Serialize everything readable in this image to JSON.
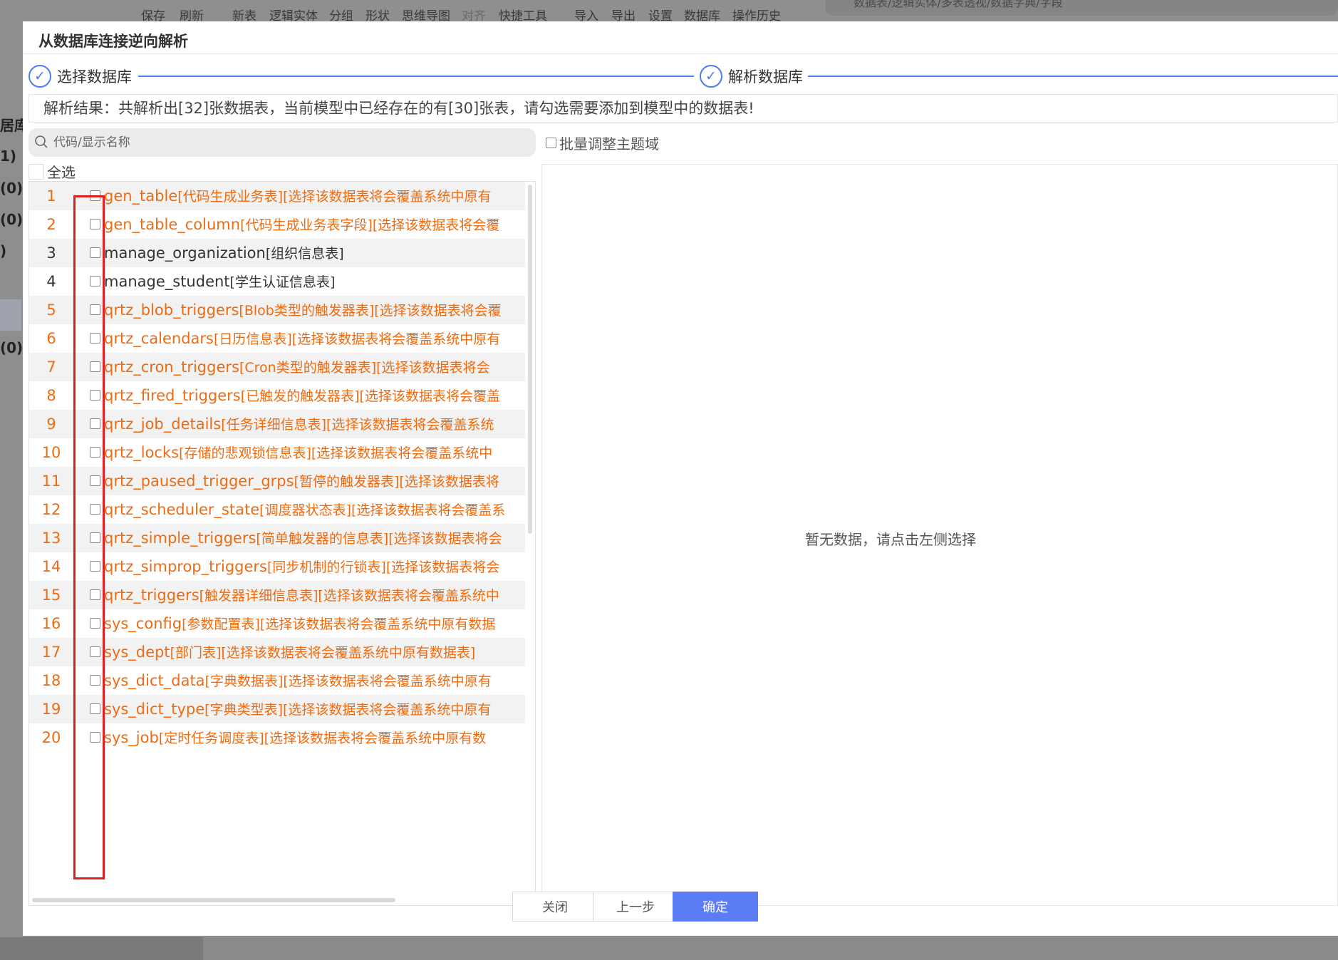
{
  "background": {
    "toolbar": [
      "保存",
      "刷新",
      "新表",
      "逻辑实体",
      "分组",
      "形状",
      "思维导图",
      "对齐",
      "快捷工具",
      "导入",
      "导出",
      "设置",
      "数据库",
      "操作历史"
    ],
    "search_placeholder": "数据表/逻辑实体/多表透视/数据字典/字段",
    "side_fragments": [
      "居库记",
      "1)",
      "(0)",
      "(0)",
      ")",
      "(0)"
    ]
  },
  "modal": {
    "title": "从数据库连接逆向解析",
    "steps": [
      {
        "label": "选择数据库",
        "icon": "check-circle-icon"
      },
      {
        "label": "解析数据库",
        "icon": "check-circle-icon"
      }
    ],
    "result_text": "解析结果：共解析出[32]张数据表，当前模型中已经存在的有[30]张表，请勾选需要添加到模型中的数据表!",
    "search_placeholder": "代码/显示名称",
    "search_value": "",
    "batch_label": "批量调整主题域",
    "select_all_label": "全选",
    "empty_text": "暂无数据，请点击左侧选择",
    "buttons": {
      "close": "关闭",
      "prev": "上一步",
      "ok": "确定"
    },
    "colors": {
      "accent": "#4a7cf6",
      "warn_text": "#ee6b12",
      "primary_button": "#5b7cf5",
      "highlight_box": "#e02020"
    },
    "rows": [
      {
        "num": "1",
        "code": "gen_table",
        "desc": "[代码生成业务表][选择该数据表将会覆盖系统中原有",
        "existing": true
      },
      {
        "num": "2",
        "code": "gen_table_column",
        "desc": "[代码生成业务表字段][选择该数据表将会覆",
        "existing": true
      },
      {
        "num": "3",
        "code": "manage_organization",
        "desc": "[组织信息表]",
        "existing": false
      },
      {
        "num": "4",
        "code": "manage_student",
        "desc": "[学生认证信息表]",
        "existing": false
      },
      {
        "num": "5",
        "code": "qrtz_blob_triggers",
        "desc": "[Blob类型的触发器表][选择该数据表将会覆",
        "existing": true
      },
      {
        "num": "6",
        "code": "qrtz_calendars",
        "desc": "[日历信息表][选择该数据表将会覆盖系统中原有",
        "existing": true
      },
      {
        "num": "7",
        "code": "qrtz_cron_triggers",
        "desc": "[Cron类型的触发器表][选择该数据表将会",
        "existing": true
      },
      {
        "num": "8",
        "code": "qrtz_fired_triggers",
        "desc": "[已触发的触发器表][选择该数据表将会覆盖",
        "existing": true
      },
      {
        "num": "9",
        "code": "qrtz_job_details",
        "desc": "[任务详细信息表][选择该数据表将会覆盖系统",
        "existing": true
      },
      {
        "num": "10",
        "code": "qrtz_locks",
        "desc": "[存储的悲观锁信息表][选择该数据表将会覆盖系统中",
        "existing": true
      },
      {
        "num": "11",
        "code": "qrtz_paused_trigger_grps",
        "desc": "[暂停的触发器表][选择该数据表将",
        "existing": true
      },
      {
        "num": "12",
        "code": "qrtz_scheduler_state",
        "desc": "[调度器状态表][选择该数据表将会覆盖系",
        "existing": true
      },
      {
        "num": "13",
        "code": "qrtz_simple_triggers",
        "desc": "[简单触发器的信息表][选择该数据表将会",
        "existing": true
      },
      {
        "num": "14",
        "code": "qrtz_simprop_triggers",
        "desc": "[同步机制的行锁表][选择该数据表将会",
        "existing": true
      },
      {
        "num": "15",
        "code": "qrtz_triggers",
        "desc": "[触发器详细信息表][选择该数据表将会覆盖系统中",
        "existing": true
      },
      {
        "num": "16",
        "code": "sys_config",
        "desc": "[参数配置表][选择该数据表将会覆盖系统中原有数据",
        "existing": true
      },
      {
        "num": "17",
        "code": "sys_dept",
        "desc": "[部门表][选择该数据表将会覆盖系统中原有数据表]",
        "existing": true
      },
      {
        "num": "18",
        "code": "sys_dict_data",
        "desc": "[字典数据表][选择该数据表将会覆盖系统中原有",
        "existing": true
      },
      {
        "num": "19",
        "code": "sys_dict_type",
        "desc": "[字典类型表][选择该数据表将会覆盖系统中原有",
        "existing": true
      },
      {
        "num": "20",
        "code": "sys_job",
        "desc": "[定时任务调度表][选择该数据表将会覆盖系统中原有数",
        "existing": true
      }
    ]
  }
}
